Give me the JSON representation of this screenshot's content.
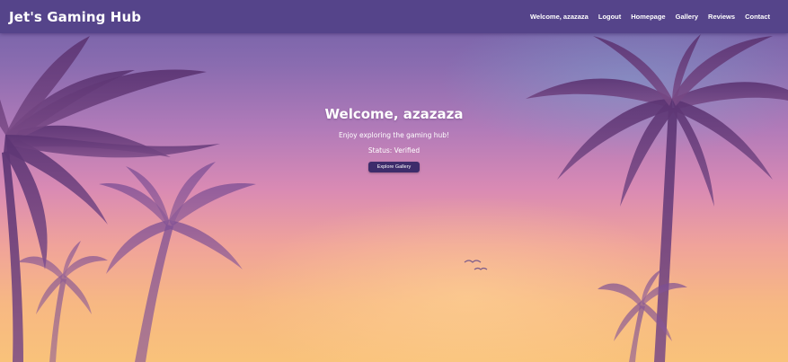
{
  "navbar": {
    "brand": "Jet's Gaming Hub",
    "welcome": "Welcome, azazaza",
    "links": [
      "Logout",
      "Homepage",
      "Gallery",
      "Reviews",
      "Contact"
    ]
  },
  "hero": {
    "title": "Welcome, azazaza",
    "subtitle": "Enjoy exploring the gaming hub!",
    "status": "Status: Verified",
    "button_label": "Explore Gallery"
  },
  "colors": {
    "navbar_bg": "#55448a",
    "button_bg": "#3d2c6b",
    "palm_silhouette": "#6a3f78"
  }
}
